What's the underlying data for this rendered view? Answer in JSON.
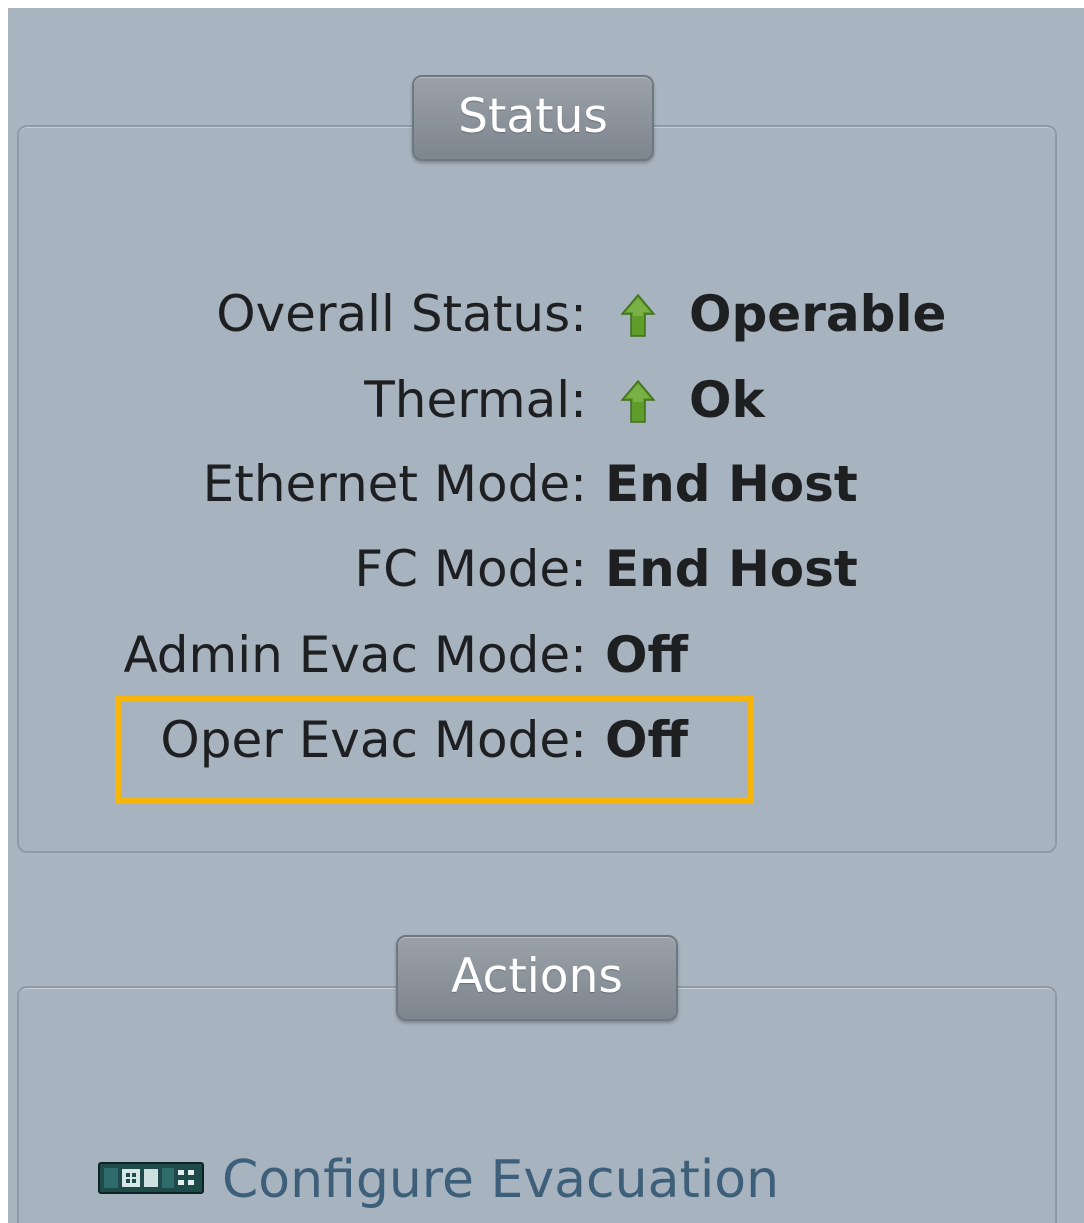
{
  "status_panel": {
    "title": "Status",
    "rows": [
      {
        "label": "Overall Status:",
        "value": "Operable",
        "icon": "green-up-arrow-icon"
      },
      {
        "label": "Thermal:",
        "value": "Ok",
        "icon": "green-up-arrow-icon"
      },
      {
        "label": "Ethernet Mode:",
        "value": "End Host"
      },
      {
        "label": "FC Mode:",
        "value": "End Host"
      },
      {
        "label": "Admin Evac Mode:",
        "value": "Off"
      },
      {
        "label": "Oper Evac Mode:",
        "value": "Off",
        "highlighted": true
      }
    ]
  },
  "actions_panel": {
    "title": "Actions",
    "items": [
      {
        "label": "Configure Evacuation",
        "icon": "fabric-interconnect-icon"
      }
    ]
  },
  "colors": {
    "background": "#a9b5c1",
    "panel_border": "#8f9aa6",
    "title_badge": "#8a9199",
    "value_text": "#1d1f21",
    "status_ok_green": "#5e9c2b",
    "highlight_box": "#f5b50a",
    "action_link": "#3d5f79"
  }
}
